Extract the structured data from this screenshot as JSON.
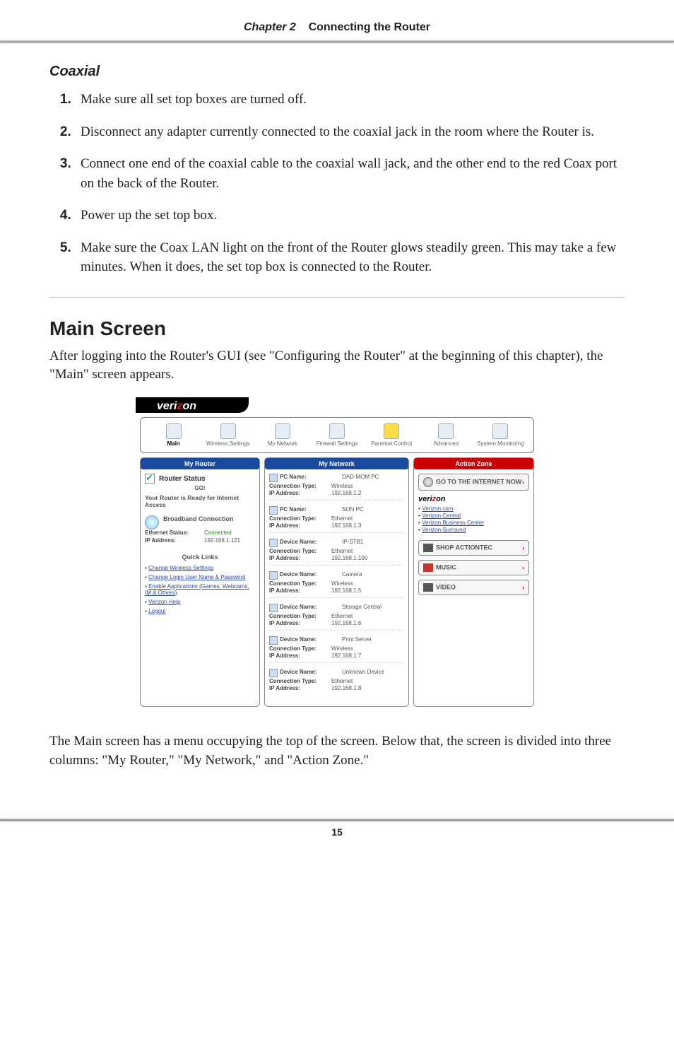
{
  "header": {
    "chapter": "Chapter 2",
    "title": "Connecting the Router"
  },
  "section_coaxial": {
    "heading": "Coaxial",
    "steps": [
      "Make sure all set top boxes are turned off.",
      "Disconnect any adapter currently connected to the coaxial jack in the room where the Router is.",
      "Connect one end of the coaxial cable to the coaxial wall jack, and the other end to the red Coax port on the back of the Router.",
      "Power up the set top box.",
      "Make sure the Coax LAN light on the front of the Router glows steadily green. This may take a few minutes. When it does, the set top box is connected to the Router."
    ]
  },
  "section_main": {
    "heading": "Main Screen",
    "intro": "After logging into the Router's GUI (see \"Configuring the Router\" at the beginning of this chapter), the \"Main\" screen appears.",
    "outro": "The Main screen has a menu occupying the top of the screen. Below that, the screen is divided into three columns: \"My Router,\" \"My Network,\" and \"Action Zone.\""
  },
  "screenshot": {
    "brand": "verizon",
    "nav": [
      "Main",
      "Wireless Settings",
      "My Network",
      "Firewall Settings",
      "Parental Control",
      "Advanced",
      "System Monitoring"
    ],
    "columns": {
      "left_title": "My Router",
      "mid_title": "My Network",
      "right_title": "Action Zone"
    },
    "router_status": {
      "label": "Router Status",
      "go": "GO!",
      "ready": "Your Router is Ready for Internet Access",
      "bb_label": "Broadband Connection",
      "eth_label": "Ethernet Status:",
      "eth_value": "Connected",
      "ip_label": "IP Address:",
      "ip_value": "192.168.1.121"
    },
    "quick_links": {
      "heading": "Quick Links",
      "items": [
        "Change Wireless Settings",
        "Change Login User Name & Password",
        "Enable Applications (Games, Webcams, IM & Others)",
        "Verizon Help",
        "Logout"
      ]
    },
    "devices": [
      {
        "name_label": "PC Name:",
        "name": "DAD-MOM PC",
        "type_label": "Connection Type:",
        "type": "Wireless",
        "ip_label": "IP Address:",
        "ip": "192.168.1.2"
      },
      {
        "name_label": "PC Name:",
        "name": "SON PC",
        "type_label": "Connection Type:",
        "type": "Ethernet",
        "ip_label": "IP Address:",
        "ip": "192.168.1.3"
      },
      {
        "name_label": "Device Name:",
        "name": "IP-STB1",
        "type_label": "Connection Type:",
        "type": "Ethernet",
        "ip_label": "IP Address:",
        "ip": "192.168.1.100"
      },
      {
        "name_label": "Device Name:",
        "name": "Camera",
        "type_label": "Connection Type:",
        "type": "Wireless",
        "ip_label": "IP Address:",
        "ip": "192.168.1.5"
      },
      {
        "name_label": "Device Name:",
        "name": "Storage Central",
        "type_label": "Connection Type:",
        "type": "Ethernet",
        "ip_label": "IP Address:",
        "ip": "192.168.1.6"
      },
      {
        "name_label": "Device Name:",
        "name": "Print Server",
        "type_label": "Connection Type:",
        "type": "Wireless",
        "ip_label": "IP Address:",
        "ip": "192.168.1.7"
      },
      {
        "name_label": "Device Name:",
        "name": "Unknown Device",
        "type_label": "Connection Type:",
        "type": "Ethernet",
        "ip_label": "IP Address:",
        "ip": "192.168.1.8"
      }
    ],
    "action": {
      "internet_btn": "GO TO THE INTERNET NOW",
      "vz_links": [
        "Verizon.com",
        "Verizon Central",
        "Verizon Business Center",
        "Verizon Surround"
      ],
      "shop_btn": "SHOP ACTIONTEC",
      "music_btn": "MUSIC",
      "video_btn": "VIDEO"
    }
  },
  "page_number": "15"
}
